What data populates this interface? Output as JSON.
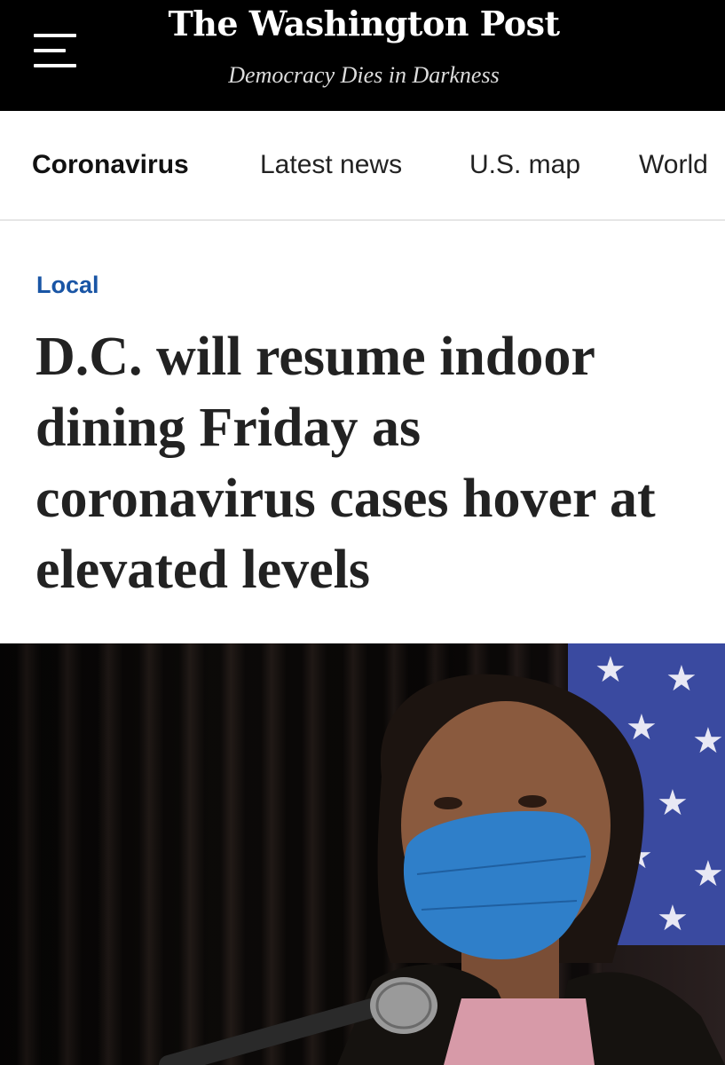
{
  "masthead": {
    "logo": "The Washington Post",
    "tagline": "Democracy Dies in Darkness"
  },
  "nav": {
    "items": [
      {
        "label": "Coronavirus",
        "active": true
      },
      {
        "label": "Latest news",
        "active": false
      },
      {
        "label": "U.S. map",
        "active": false
      },
      {
        "label": "World",
        "active": false
      }
    ]
  },
  "article": {
    "section": "Local",
    "headline": "D.C. will resume indoor dining Friday as coronavirus cases hover at elevated levels"
  },
  "colors": {
    "masthead_bg": "#000000",
    "kicker": "#1955a5",
    "mask": "#2f7fc9",
    "flag_blue": "#3a4aa0"
  }
}
